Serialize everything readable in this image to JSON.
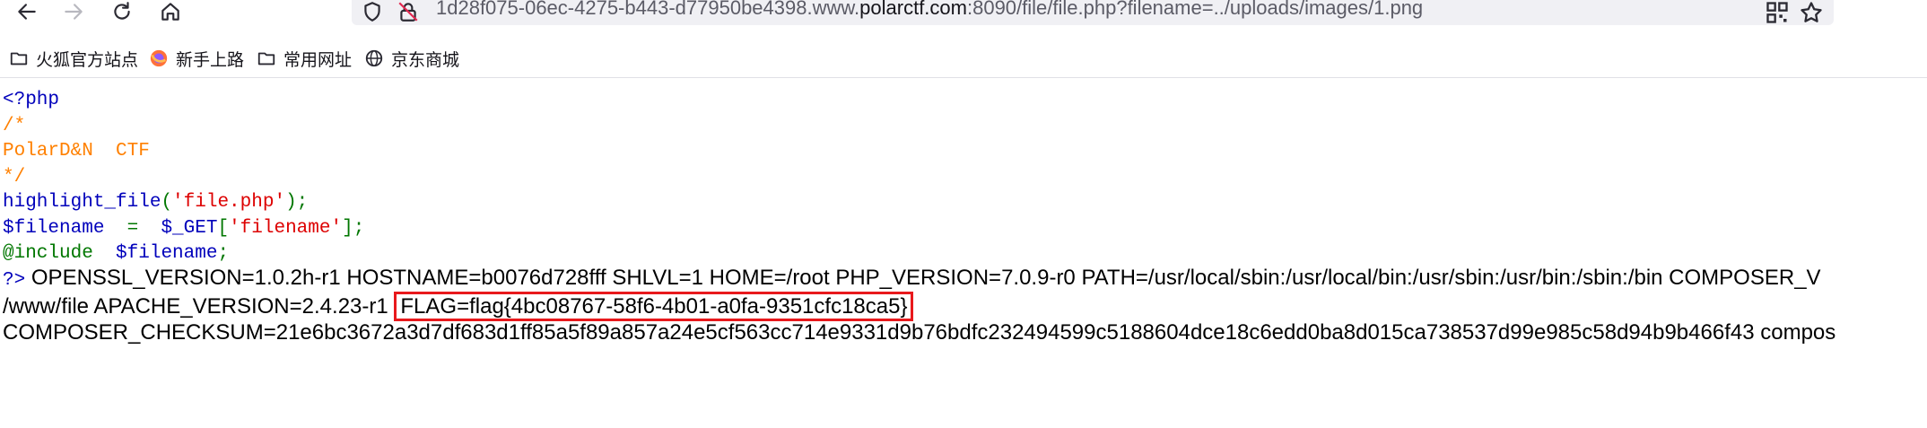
{
  "browser": {
    "url_prefix": "1d28f075-06ec-4275-b443-d77950be4398.www.",
    "url_domain": "polarctf.com",
    "url_suffix": ":8090/file/file.php?filename=../uploads/images/1.png"
  },
  "bookmarks": [
    {
      "label": "火狐官方站点",
      "icon": "folder-icon"
    },
    {
      "label": "新手上路",
      "icon": "firefox-icon"
    },
    {
      "label": "常用网址",
      "icon": "folder-icon"
    },
    {
      "label": "京东商城",
      "icon": "globe-icon"
    }
  ],
  "code": {
    "line1": "<?php",
    "line2": "/*",
    "line3": "PolarD&N  CTF",
    "line4": "*/",
    "line5_func": "highlight_file",
    "line5_open": "(",
    "line5_str": "'file.php'",
    "line5_close": ");",
    "line6_var": "$filename",
    "line6_eq": "  =  ",
    "line6_get": "$_GET",
    "line6_br": "[",
    "line6_str": "'filename'",
    "line6_end": "];",
    "line7_inc": "@include",
    "line7_sp": "  ",
    "line7_var": "$filename",
    "line7_end": ";"
  },
  "output": {
    "php_close": "?>",
    "line1_text": " OPENSSL_VERSION=1.0.2h-r1 HOSTNAME=b0076d728fff SHLVL=1 HOME=/root PHP_VERSION=7.0.9-r0 PATH=/usr/local/sbin:/usr/local/bin:/usr/sbin:/usr/bin:/sbin:/bin COMPOSER_V",
    "line2_text": "/www/file APACHE_VERSION=2.4.23-r1 ",
    "flag": "FLAG=flag{4bc08767-58f6-4b01-a0fa-9351cfc18ca5}",
    "line3_text": "COMPOSER_CHECKSUM=21e6bc3672a3d7df683d1ff85a5f89a857a24e5cf563cc714e9331d9b76bdfc232494599c5188604dce18c6edd0ba8d015ca738537d99e985c58d94b9b466f43 compos"
  },
  "colors": {
    "highlight_box": "#e8191c",
    "php_default": "#0000bb",
    "php_comment": "#ff8000",
    "php_keyword": "#007700",
    "php_string": "#dd0000"
  }
}
